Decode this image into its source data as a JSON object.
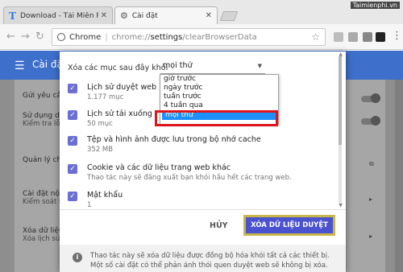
{
  "browser": {
    "tabs": [
      {
        "title": "Download - Tải Miễn Phí",
        "icon": "taimienphi-logo-icon"
      },
      {
        "title": "Cài đặt",
        "icon": "gear-icon"
      }
    ],
    "watermark": "Taimienphi.vn",
    "omnibox": {
      "app": "Chrome",
      "scheme": "chrome://",
      "host": "settings",
      "path": "/clearBrowserData"
    }
  },
  "settings_bg": {
    "title": "Cài đặt",
    "rows": [
      {
        "title": "Gửi yêu cầ",
        "sub": ""
      },
      {
        "title": "Sử dụng dị",
        "sub": "Kiểm tra lỗ"
      },
      {
        "title": "Quản lý chứ",
        "sub": ""
      },
      {
        "title": "Cài đặt nội",
        "sub": "Kiểm soát t"
      },
      {
        "title": "Xóa dữ liệu",
        "sub": "Xóa lịch sử"
      }
    ]
  },
  "dialog": {
    "time_label": "Xóa các mục sau đây khỏi",
    "time_selected": "mọi thứ",
    "time_options": [
      "giờ trước",
      "ngày trước",
      "tuần trước",
      "4 tuần qua",
      "mọi thứ"
    ],
    "items": [
      {
        "title": "Lịch sử duyệt web",
        "sub": "1.177 mục",
        "checked": true
      },
      {
        "title": "Lịch sử tải xuống",
        "sub": "50 mục",
        "checked": true
      },
      {
        "title": "Tệp và hình ảnh được lưu trong bộ nhớ cache",
        "sub": "352 MB",
        "checked": true
      },
      {
        "title": "Cookie và các dữ liệu trang web khác",
        "sub": "Thao tác này sẽ đăng xuất bạn khỏi hầu hết các trang web.",
        "checked": true
      },
      {
        "title": "Mật khẩu",
        "sub": "1",
        "checked": true
      }
    ],
    "cancel_label": "HỦY",
    "clear_label": "XÓA DỮ LIỆU DUYỆT WEB",
    "footer_text": "Thao tác này sẽ xóa dữ liệu được đồng bộ hóa khỏi tất cả các thiết bị. Một số cài đặt có thể phản ánh thói quen duyệt web sẽ không bị xóa."
  },
  "colors": {
    "accent": "#4b52cf",
    "header": "#3e6fcb",
    "highlight": "#e0151c",
    "selected_option": "#1e90ff"
  }
}
